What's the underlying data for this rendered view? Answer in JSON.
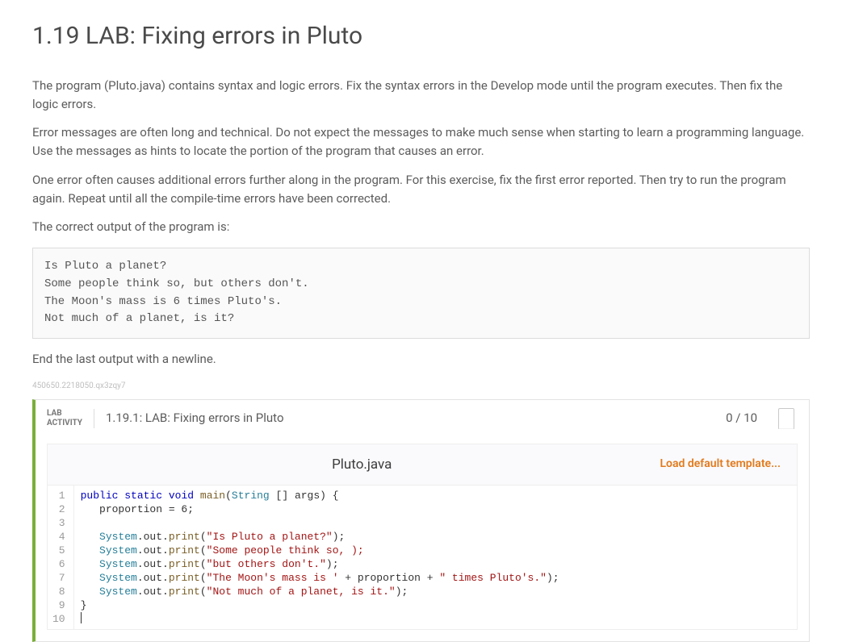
{
  "title": "1.19 LAB: Fixing errors in Pluto",
  "intro": {
    "p1": "The program (Pluto.java) contains syntax and logic errors. Fix the syntax errors in the Develop mode until the program executes. Then fix the logic errors.",
    "p2": "Error messages are often long and technical. Do not expect the messages to make much sense when starting to learn a programming language. Use the messages as hints to locate the portion of the program that causes an error.",
    "p3": "One error often causes additional errors further along in the program. For this exercise, fix the first error reported. Then try to run the program again. Repeat until all the compile-time errors have been corrected.",
    "p4": "The correct output of the program is:"
  },
  "expected_output": "Is Pluto a planet?\nSome people think so, but others don't.\nThe Moon's mass is 6 times Pluto's.\nNot much of a planet, is it?",
  "after_block": "End the last output with a newline.",
  "hash_id": "450650.2218050.qx3zqy7",
  "lab": {
    "label_line1": "LAB",
    "label_line2": "ACTIVITY",
    "title": "1.19.1: LAB: Fixing errors in Pluto",
    "score": "0 / 10",
    "file_name": "Pluto.java",
    "load_default": "Load default template..."
  },
  "code": {
    "lines": [
      {
        "n": "1",
        "tokens": [
          [
            "kw",
            "public"
          ],
          [
            "",
            " "
          ],
          [
            "kw",
            "static"
          ],
          [
            "",
            " "
          ],
          [
            "kw",
            "void"
          ],
          [
            "",
            " "
          ],
          [
            "mth",
            "main"
          ],
          [
            "",
            "("
          ],
          [
            "cls",
            "String"
          ],
          [
            "",
            " [] args) {"
          ]
        ]
      },
      {
        "n": "2",
        "tokens": [
          [
            "",
            "   proportion = 6;"
          ]
        ]
      },
      {
        "n": "3",
        "tokens": [
          [
            "",
            ""
          ]
        ]
      },
      {
        "n": "4",
        "tokens": [
          [
            "",
            "   "
          ],
          [
            "cls",
            "System"
          ],
          [
            "",
            ".out."
          ],
          [
            "mth",
            "print"
          ],
          [
            "",
            "("
          ],
          [
            "str",
            "\"Is Pluto a planet?\""
          ],
          [
            "",
            ");"
          ]
        ]
      },
      {
        "n": "5",
        "tokens": [
          [
            "",
            "   "
          ],
          [
            "cls",
            "System"
          ],
          [
            "",
            ".out."
          ],
          [
            "mth",
            "print"
          ],
          [
            "",
            "("
          ],
          [
            "str",
            "\"Some people think so, );"
          ]
        ]
      },
      {
        "n": "6",
        "tokens": [
          [
            "",
            "   "
          ],
          [
            "cls",
            "System"
          ],
          [
            "",
            ".out."
          ],
          [
            "mth",
            "print"
          ],
          [
            "",
            "("
          ],
          [
            "str",
            "\"but others don't.\""
          ],
          [
            "",
            ");"
          ]
        ]
      },
      {
        "n": "7",
        "tokens": [
          [
            "",
            "   "
          ],
          [
            "cls",
            "System"
          ],
          [
            "",
            ".out."
          ],
          [
            "mth",
            "print"
          ],
          [
            "",
            "("
          ],
          [
            "str",
            "\"The Moon's mass is '"
          ],
          [
            "",
            " + proportion + "
          ],
          [
            "str",
            "\" times Pluto's.\""
          ],
          [
            "",
            ");"
          ]
        ]
      },
      {
        "n": "8",
        "tokens": [
          [
            "",
            "   "
          ],
          [
            "cls",
            "System"
          ],
          [
            "",
            ".out."
          ],
          [
            "mth",
            "print"
          ],
          [
            "",
            "("
          ],
          [
            "str",
            "\"Not much of a planet, is it.\""
          ],
          [
            "",
            ");"
          ]
        ]
      },
      {
        "n": "9",
        "tokens": [
          [
            "",
            "}"
          ]
        ]
      },
      {
        "n": "10",
        "tokens": [
          [
            "",
            ""
          ]
        ]
      }
    ]
  }
}
